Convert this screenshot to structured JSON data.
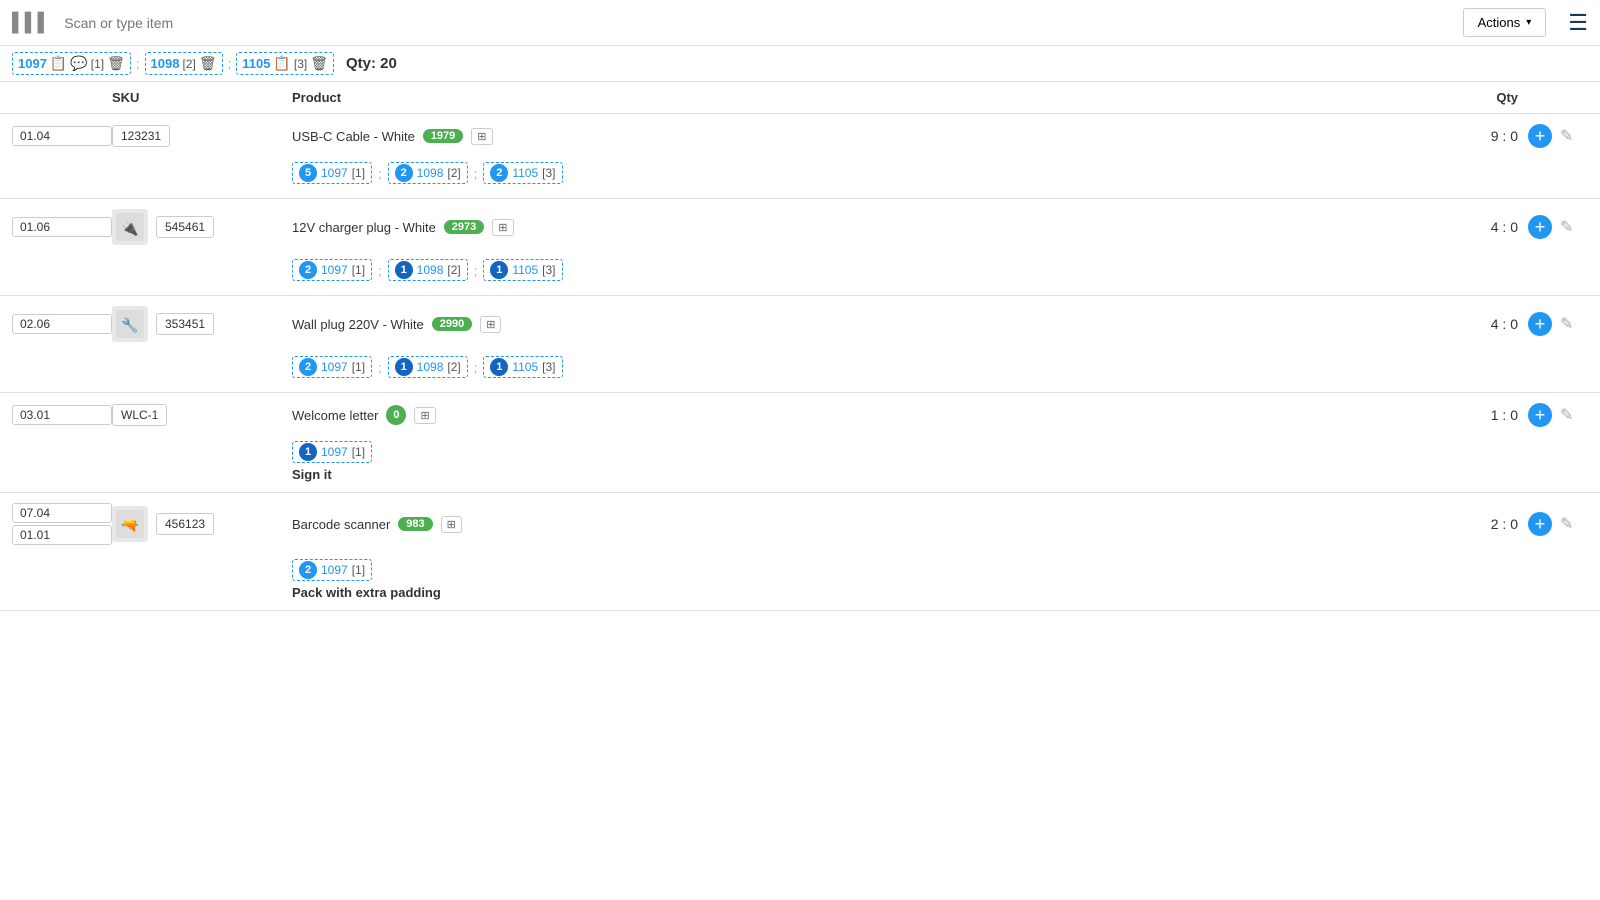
{
  "topbar": {
    "scan_placeholder": "Scan or type item",
    "actions_label": "Actions",
    "barcode_symbol": "▌▌▌"
  },
  "tabs": [
    {
      "id": "1097",
      "count": "[1]",
      "has_copy": true,
      "has_comment": true,
      "has_delete": true
    },
    {
      "id": "1098",
      "count": "[2]",
      "has_copy": false,
      "has_comment": false,
      "has_delete": true
    },
    {
      "id": "1105",
      "count": "[3]",
      "has_copy": true,
      "has_comment": false,
      "has_delete": true
    }
  ],
  "qty_label": "Qty:",
  "qty_value": "20",
  "table": {
    "headers": [
      "",
      "SKU",
      "Product",
      "Qty",
      ""
    ],
    "rows": [
      {
        "locations": [
          "01.04"
        ],
        "has_image": false,
        "sku": "123231",
        "product_name": "USB-C Cable - White",
        "badge": "1979",
        "qty": "9 : 0",
        "chips": [
          {
            "num": "5",
            "id": "1097",
            "count": "[1]",
            "dark": false
          },
          {
            "num": "2",
            "id": "1098",
            "count": "[2]",
            "dark": false
          },
          {
            "num": "2",
            "id": "1105",
            "count": "[3]",
            "dark": false
          }
        ],
        "note": null
      },
      {
        "locations": [
          "01.06"
        ],
        "has_image": true,
        "image_symbol": "🔌",
        "sku": "545461",
        "product_name": "12V charger plug - White",
        "badge": "2973",
        "qty": "4 : 0",
        "chips": [
          {
            "num": "2",
            "id": "1097",
            "count": "[1]",
            "dark": false
          },
          {
            "num": "1",
            "id": "1098",
            "count": "[2]",
            "dark": true
          },
          {
            "num": "1",
            "id": "1105",
            "count": "[3]",
            "dark": true
          }
        ],
        "note": null
      },
      {
        "locations": [
          "02.06"
        ],
        "has_image": true,
        "image_symbol": "🔧",
        "sku": "353451",
        "product_name": "Wall plug 220V - White",
        "badge": "2990",
        "qty": "4 : 0",
        "chips": [
          {
            "num": "2",
            "id": "1097",
            "count": "[1]",
            "dark": false
          },
          {
            "num": "1",
            "id": "1098",
            "count": "[2]",
            "dark": true
          },
          {
            "num": "1",
            "id": "1105",
            "count": "[3]",
            "dark": true
          }
        ],
        "note": null
      },
      {
        "locations": [
          "03.01"
        ],
        "has_image": false,
        "sku": "WLC-1",
        "product_name": "Welcome letter",
        "badge": "0",
        "badge_zero": true,
        "qty": "1 : 0",
        "chips": [
          {
            "num": "1",
            "id": "1097",
            "count": "[1]",
            "dark": true
          }
        ],
        "note": "Sign it"
      },
      {
        "locations": [
          "07.04",
          "01.01"
        ],
        "has_image": true,
        "image_symbol": "🔫",
        "sku": "456123",
        "product_name": "Barcode scanner",
        "badge": "983",
        "qty": "2 : 0",
        "chips": [
          {
            "num": "2",
            "id": "1097",
            "count": "[1]",
            "dark": false
          }
        ],
        "note": "Pack with extra padding"
      }
    ]
  }
}
